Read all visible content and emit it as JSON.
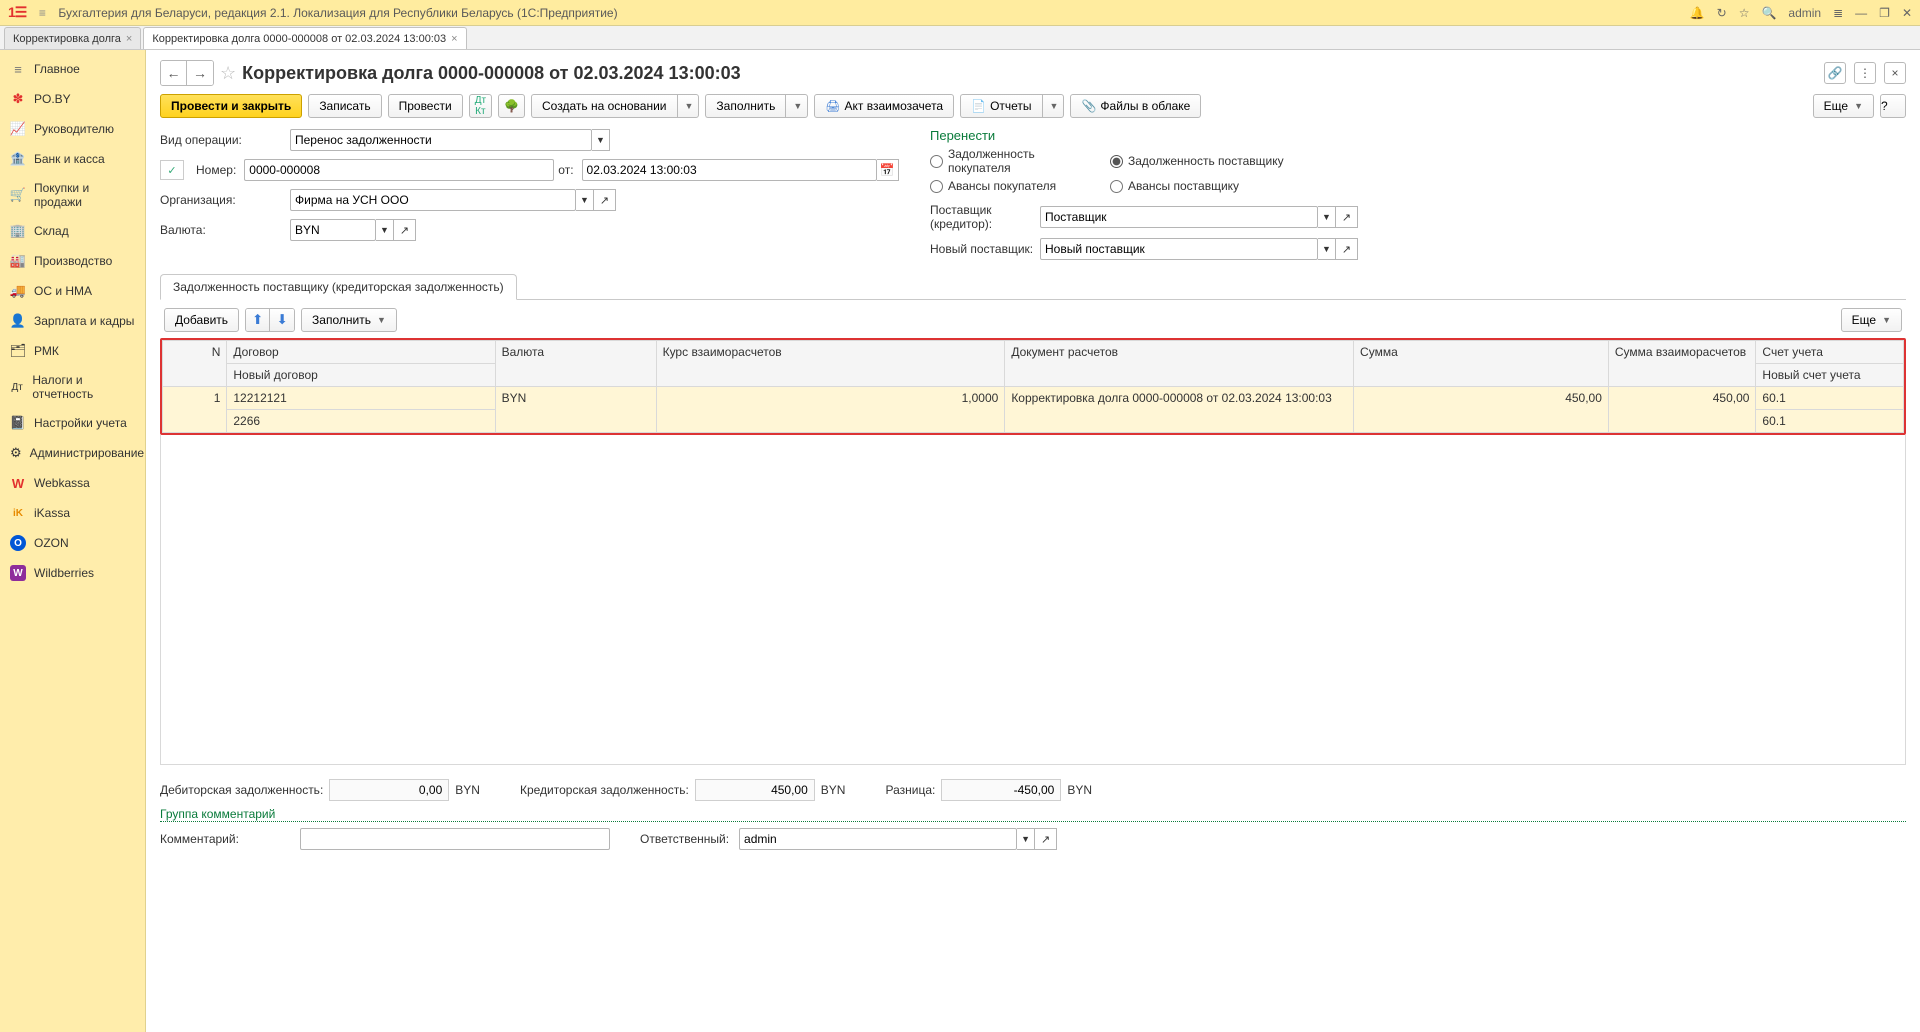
{
  "app_title": "Бухгалтерия для Беларуси, редакция 2.1. Локализация для Республики Беларусь   (1С:Предприятие)",
  "user": "admin",
  "tabs": [
    {
      "label": "Корректировка долга",
      "active": false
    },
    {
      "label": "Корректировка долга 0000-000008 от 02.03.2024 13:00:03",
      "active": true
    }
  ],
  "sidebar": {
    "items": [
      {
        "icon": "≡",
        "label": "Главное",
        "color": "#777"
      },
      {
        "icon": "✽",
        "label": "PO.BY",
        "color": "#e2302e"
      },
      {
        "icon": "📈",
        "label": "Руководителю",
        "color": "#555"
      },
      {
        "icon": "🏦",
        "label": "Банк и касса",
        "color": "#555"
      },
      {
        "icon": "🛒",
        "label": "Покупки и продажи",
        "color": "#555"
      },
      {
        "icon": "🏢",
        "label": "Склад",
        "color": "#555"
      },
      {
        "icon": "🏭",
        "label": "Производство",
        "color": "#555"
      },
      {
        "icon": "🚚",
        "label": "ОС и НМА",
        "color": "#555"
      },
      {
        "icon": "👤",
        "label": "Зарплата и кадры",
        "color": "#555"
      },
      {
        "icon": "🗂",
        "label": "РМК",
        "color": "#555"
      },
      {
        "icon": "Дт",
        "label": "Налоги и отчетность",
        "color": "#555"
      },
      {
        "icon": "📓",
        "label": "Настройки учета",
        "color": "#555"
      },
      {
        "icon": "⚙",
        "label": "Администрирование",
        "color": "#555"
      },
      {
        "icon": "W",
        "label": "Webkassa",
        "color": "#e2302e"
      },
      {
        "icon": "iK",
        "label": "iKassa",
        "color": "#e68a00"
      },
      {
        "icon": "O",
        "label": "OZON",
        "color": "#0056d6"
      },
      {
        "icon": "W",
        "label": "Wildberries",
        "color": "#8e2d9b"
      }
    ]
  },
  "document": {
    "title": "Корректировка долга 0000-000008 от 02.03.2024 13:00:03",
    "buttons": {
      "post_close": "Провести и закрыть",
      "save": "Записать",
      "post": "Провести",
      "create_based": "Создать на основании",
      "fill": "Заполнить",
      "act": "Акт взаимозачета",
      "reports": "Отчеты",
      "cloud_files": "Файлы в облаке",
      "more": "Еще"
    },
    "labels": {
      "op_type": "Вид операции:",
      "number": "Номер:",
      "from": "от:",
      "org": "Организация:",
      "currency": "Валюта:",
      "transfer": "Перенести",
      "r1": "Задолженность покупателя",
      "r2": "Задолженность поставщику",
      "r3": "Авансы покупателя",
      "r4": "Авансы поставщику",
      "supplier": "Поставщик (кредитор):",
      "new_supplier": "Новый поставщик:"
    },
    "values": {
      "op_type": "Перенос задолженности",
      "number": "0000-000008",
      "datetime": "02.03.2024 13:00:03",
      "org": "Фирма на УСН ООО",
      "currency": "BYN",
      "supplier": "Поставщик",
      "new_supplier": "Новый поставщик"
    },
    "radio_selected": "r2",
    "subtab": "Задолженность поставщику (кредиторская задолженность)",
    "table_toolbar": {
      "add": "Добавить",
      "fill": "Заполнить",
      "more": "Еще"
    },
    "table": {
      "headers": {
        "n": "N",
        "dogovor": "Договор",
        "dogovor2": "Новый договор",
        "val": "Валюта",
        "kurs": "Курс взаиморасчетов",
        "doc": "Документ расчетов",
        "sum": "Сумма",
        "sum2": "Сумма взаиморасчетов",
        "acct": "Счет учета",
        "acct2": "Новый счет учета"
      },
      "rows": [
        {
          "n": "1",
          "dogovor": "12212121",
          "dogovor2": "2266",
          "val": "BYN",
          "kurs": "1,0000",
          "doc": "Корректировка долга 0000-000008 от 02.03.2024 13:00:03",
          "sum": "450,00",
          "sum2": "450,00",
          "acct": "60.1",
          "acct2": "60.1"
        }
      ]
    },
    "totals": {
      "deb_label": "Дебиторская задолженность:",
      "deb": "0,00",
      "deb_cur": "BYN",
      "cred_label": "Кредиторская задолженность:",
      "cred": "450,00",
      "cred_cur": "BYN",
      "diff_label": "Разница:",
      "diff": "-450,00",
      "diff_cur": "BYN"
    },
    "comment_group": "Группа комментарий",
    "comment_label": "Комментарий:",
    "responsible_label": "Ответственный:",
    "responsible": "admin"
  }
}
